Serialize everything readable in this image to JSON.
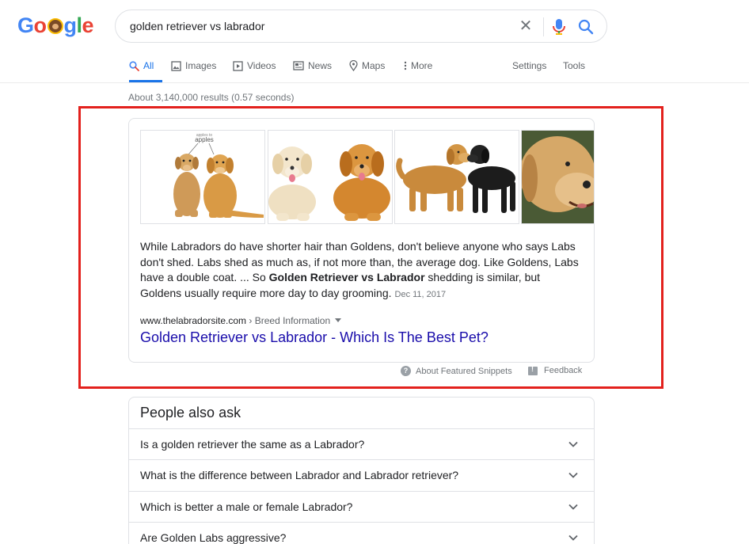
{
  "logo": {
    "letters": [
      "G",
      "o",
      "o",
      "g",
      "l",
      "e"
    ],
    "text": "Google"
  },
  "search": {
    "query": "golden retriever vs labrador",
    "clear_icon": "close-icon",
    "mic_icon": "microphone-icon",
    "search_icon": "search-icon"
  },
  "tabs": [
    {
      "label": "All",
      "icon": "search-icon",
      "active": true
    },
    {
      "label": "Images",
      "icon": "image-icon"
    },
    {
      "label": "Videos",
      "icon": "play-icon"
    },
    {
      "label": "News",
      "icon": "newspaper-icon"
    },
    {
      "label": "Maps",
      "icon": "map-pin-icon"
    },
    {
      "label": "More",
      "icon": "vertical-dots-icon"
    },
    {
      "label": "Settings"
    },
    {
      "label": "Tools"
    }
  ],
  "stats": "About 3,140,000 results (0.57 seconds)",
  "snippet": {
    "images": [
      {
        "caption": "apples to apples",
        "caption_line1": "apples to",
        "caption_line2": "apples"
      },
      {
        "caption": ""
      },
      {
        "caption": ""
      },
      {
        "caption": ""
      }
    ],
    "text_before": "While Labradors do have shorter hair than Goldens, don't believe anyone who says Labs don't shed. Labs shed as much as, if not more than, the average dog. Like Goldens, Labs have a double coat. ... So ",
    "text_bold": "Golden Retriever vs Labrador",
    "text_after": " shedding is similar, but Goldens usually require more day to day grooming.",
    "date": "Dec 11, 2017",
    "cite_domain": "www.thelabradorsite.com",
    "cite_path": " › Breed Information",
    "link_title": "Golden Retriever vs Labrador - Which Is The Best Pet?",
    "about_label": "About Featured Snippets",
    "feedback_label": "Feedback"
  },
  "people_also_ask": {
    "title": "People also ask",
    "questions": [
      "Is a golden retriever the same as a Labrador?",
      "What is the difference between Labrador and Labrador retriever?",
      "Which is better a male or female Labrador?",
      "Are Golden Labs aggressive?"
    ]
  },
  "colors": {
    "highlight_box": "#e3211d",
    "link": "#1a0dab",
    "active_tab": "#1a73e8"
  }
}
